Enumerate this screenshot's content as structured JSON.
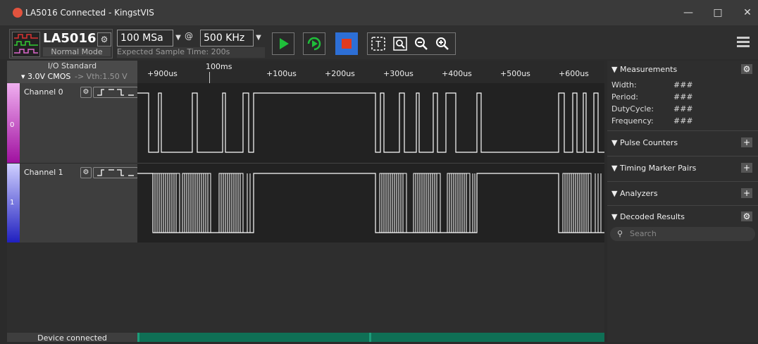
{
  "window": {
    "title": "LA5016 Connected - KingstVIS",
    "controls": [
      "minimize-icon",
      "maximize-icon",
      "close-icon"
    ]
  },
  "toolbar": {
    "device_name": "LA5016",
    "device_mode": "Normal Mode",
    "sample_rate": "100 MSa",
    "at": "@",
    "frequency": "500 KHz",
    "expected_time": "Expected Sample Time: 200s",
    "buttons": [
      "play-icon",
      "loop-play-icon",
      "stop-icon",
      "text-cursor-icon",
      "zoom-fit-icon",
      "zoom-out-icon",
      "zoom-in-icon"
    ],
    "colors": {
      "play": "#1fbf3a",
      "stop": "#e03a1e",
      "stop_bg": "#2d6fd6"
    }
  },
  "io": {
    "label": "I/O Standard",
    "value": "▾ 3.0V CMOS",
    "vth": "-> Vth:1.50 V"
  },
  "ruler": {
    "marker": "100ms",
    "ticks": [
      "+900us",
      "+100us",
      "+200us",
      "+300us",
      "+400us",
      "+500us",
      "+600us"
    ]
  },
  "channels": [
    {
      "name": "Channel 0",
      "index": "0",
      "color": "#c020c0"
    },
    {
      "name": "Channel 1",
      "index": "1",
      "color": "#3030d0"
    }
  ],
  "status": {
    "text": "Device connected"
  },
  "panel": {
    "measurements": {
      "title": "▼ Measurements",
      "rows": [
        {
          "label": "Width:",
          "value": "###"
        },
        {
          "label": "Period:",
          "value": "###"
        },
        {
          "label": "DutyCycle:",
          "value": "###"
        },
        {
          "label": "Frequency:",
          "value": "###"
        }
      ]
    },
    "pulse_counters": "▼ Pulse Counters",
    "timing_pairs": "▼ Timing Marker Pairs",
    "analyzers": "▼ Analyzers",
    "decoded": "▼ Decoded Results",
    "search_placeholder": "Search"
  }
}
